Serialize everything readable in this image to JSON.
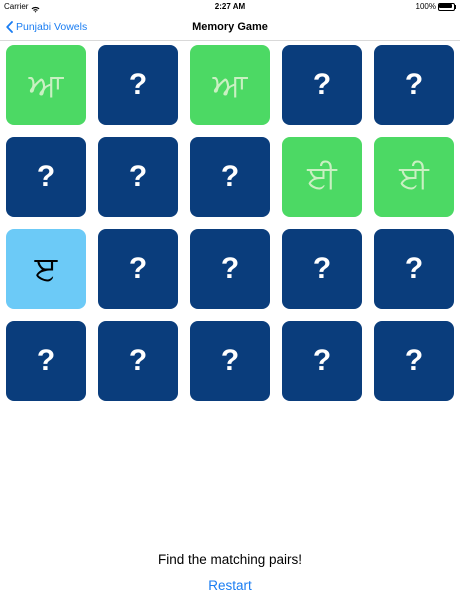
{
  "status_bar": {
    "carrier": "Carrier",
    "time": "2:27 AM",
    "battery_text": "100%",
    "battery_level": 1.0
  },
  "nav": {
    "back_label": "Punjabi Vowels",
    "title": "Memory Game"
  },
  "colors": {
    "hidden_card": "#0a3d7c",
    "matched_card": "#4cd964",
    "revealed_card": "#6ccaf7",
    "accent": "#1a7df2"
  },
  "cards": [
    {
      "state": "matched",
      "text": "ਆ"
    },
    {
      "state": "hidden",
      "text": "?"
    },
    {
      "state": "matched",
      "text": "ਆ"
    },
    {
      "state": "hidden",
      "text": "?"
    },
    {
      "state": "hidden",
      "text": "?"
    },
    {
      "state": "hidden",
      "text": "?"
    },
    {
      "state": "hidden",
      "text": "?"
    },
    {
      "state": "hidden",
      "text": "?"
    },
    {
      "state": "matched",
      "text": "ਈ"
    },
    {
      "state": "matched",
      "text": "ਈ"
    },
    {
      "state": "revealed",
      "text": "ੲ"
    },
    {
      "state": "hidden",
      "text": "?"
    },
    {
      "state": "hidden",
      "text": "?"
    },
    {
      "state": "hidden",
      "text": "?"
    },
    {
      "state": "hidden",
      "text": "?"
    },
    {
      "state": "hidden",
      "text": "?"
    },
    {
      "state": "hidden",
      "text": "?"
    },
    {
      "state": "hidden",
      "text": "?"
    },
    {
      "state": "hidden",
      "text": "?"
    },
    {
      "state": "hidden",
      "text": "?"
    }
  ],
  "footer": {
    "message": "Find the matching pairs!",
    "restart_label": "Restart"
  }
}
